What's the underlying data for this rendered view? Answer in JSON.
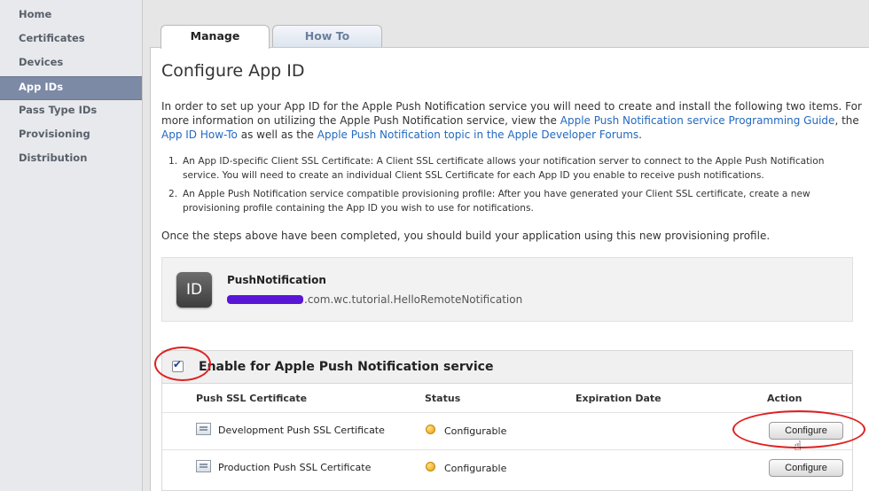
{
  "sidebar": {
    "items": [
      {
        "label": "Home"
      },
      {
        "label": "Certificates"
      },
      {
        "label": "Devices"
      },
      {
        "label": "App IDs"
      },
      {
        "label": "Pass Type IDs"
      },
      {
        "label": "Provisioning"
      },
      {
        "label": "Distribution"
      }
    ],
    "active_index": 3
  },
  "tabs": [
    {
      "label": "Manage",
      "active": true
    },
    {
      "label": "How To",
      "active": false
    }
  ],
  "page": {
    "title": "Configure App ID",
    "intro_text_1": "In order to set up your App ID for the Apple Push Notification service you will need to create and install the following two items. For more information on utilizing the Apple Push Notification service, view the ",
    "link_programming_guide": "Apple Push Notification service Programming Guide",
    "intro_text_2": ", the ",
    "link_appid_howto": "App ID How-To",
    "intro_text_3": " as well as the ",
    "link_forums": "Apple Push Notification topic in the Apple Developer Forums",
    "intro_text_4": ".",
    "steps": [
      {
        "num": "1.",
        "text": "An App ID-specific Client SSL Certificate: A Client SSL certificate allows your notification server to connect to the Apple Push Notification service. You will need to create an individual Client SSL Certificate for each App ID you enable to receive push notifications."
      },
      {
        "num": "2.",
        "text": "An Apple Push Notification service compatible provisioning profile: After you have generated your Client SSL certificate, create a new provisioning profile containing the App ID you wish to use for notifications."
      }
    ],
    "after_steps": "Once the steps above have been completed, you should build your application using this new provisioning profile."
  },
  "app_id": {
    "icon_text": "ID",
    "name": "PushNotification",
    "bundle_suffix": ".com.wc.tutorial.HelloRemoteNotification"
  },
  "push_service": {
    "title": "Enable for Apple Push Notification service",
    "enabled": true,
    "columns": {
      "certificate": "Push SSL Certificate",
      "status": "Status",
      "expiration": "Expiration Date",
      "action": "Action"
    },
    "rows": [
      {
        "certificate": "Development Push SSL Certificate",
        "status": "Configurable",
        "expiration": "",
        "action": "Configure"
      },
      {
        "certificate": "Production Push SSL Certificate",
        "status": "Configurable",
        "expiration": "",
        "action": "Configure"
      }
    ]
  },
  "colors": {
    "link": "#2369c0",
    "sidebar_active": "#7c8aa6",
    "annotation": "#e02020",
    "status_configurable": "#f0b428"
  }
}
